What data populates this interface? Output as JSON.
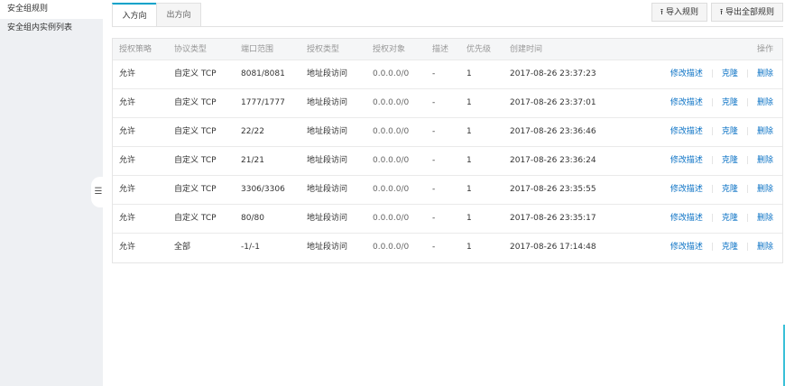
{
  "sidebar": {
    "items": [
      "安全组规则",
      "安全组内实例列表"
    ]
  },
  "tabs": [
    "入方向",
    "出方向"
  ],
  "buttons": {
    "import": "导入规则",
    "export": "导出全部规则"
  },
  "table": {
    "headers": [
      "授权策略",
      "协议类型",
      "端口范围",
      "授权类型",
      "授权对象",
      "描述",
      "优先级",
      "创建时间",
      "操作"
    ],
    "rows": [
      [
        "允许",
        "自定义 TCP",
        "8081/8081",
        "地址段访问",
        "0.0.0.0/0",
        "-",
        "1",
        "2017-08-26 23:37:23"
      ],
      [
        "允许",
        "自定义 TCP",
        "1777/1777",
        "地址段访问",
        "0.0.0.0/0",
        "-",
        "1",
        "2017-08-26 23:37:01"
      ],
      [
        "允许",
        "自定义 TCP",
        "22/22",
        "地址段访问",
        "0.0.0.0/0",
        "-",
        "1",
        "2017-08-26 23:36:46"
      ],
      [
        "允许",
        "自定义 TCP",
        "21/21",
        "地址段访问",
        "0.0.0.0/0",
        "-",
        "1",
        "2017-08-26 23:36:24"
      ],
      [
        "允许",
        "自定义 TCP",
        "3306/3306",
        "地址段访问",
        "0.0.0.0/0",
        "-",
        "1",
        "2017-08-26 23:35:55"
      ],
      [
        "允许",
        "自定义 TCP",
        "80/80",
        "地址段访问",
        "0.0.0.0/0",
        "-",
        "1",
        "2017-08-26 23:35:17"
      ],
      [
        "允许",
        "全部",
        "-1/-1",
        "地址段访问",
        "0.0.0.0/0",
        "-",
        "1",
        "2017-08-26 17:14:48"
      ]
    ],
    "actions": [
      "修改描述",
      "克隆",
      "删除"
    ]
  }
}
